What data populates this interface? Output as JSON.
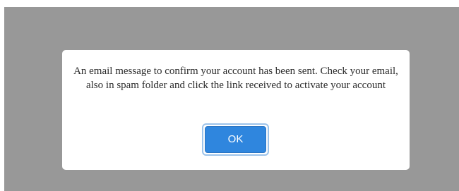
{
  "dialog": {
    "message": "An email message to confirm your account has been sent. Check your email, also in spam folder and click the link received to activate your account",
    "ok_label": "OK"
  },
  "colors": {
    "overlay": "#989898",
    "dialog_background": "#ffffff",
    "button": "#2f86de",
    "button_focus_ring": "#9cc3ea",
    "text": "#2b2b2b"
  }
}
